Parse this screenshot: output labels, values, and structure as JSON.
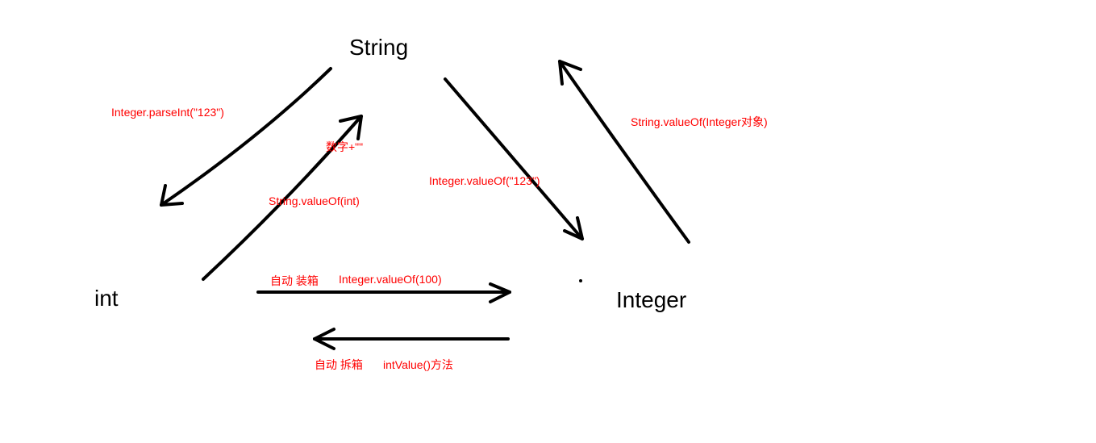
{
  "nodes": {
    "string": "String",
    "int": "int",
    "integer": "Integer"
  },
  "labels": {
    "string_to_int": "Integer.parseInt(\"123\")",
    "int_to_string_concat": "数字+\"\"",
    "int_to_string_valueof": "String.valueOf(int)",
    "string_to_integer": "Integer.valueOf(\"123\")",
    "integer_to_string": "String.valueOf(Integer对象)",
    "int_to_integer_auto": "自动 装箱",
    "int_to_integer_method": "Integer.valueOf(100)",
    "integer_to_int_auto": "自动 拆箱",
    "integer_to_int_method": "intValue()方法"
  }
}
